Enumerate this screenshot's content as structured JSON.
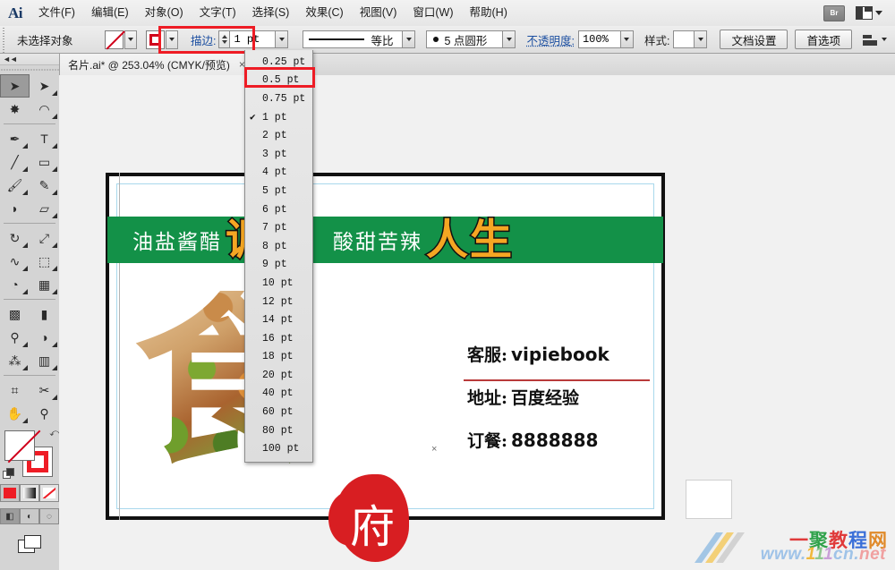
{
  "app": {
    "name": "Ai",
    "logo_text": "Ai"
  },
  "menubar": {
    "items": [
      {
        "label": "文件(F)",
        "name": "menu-file"
      },
      {
        "label": "编辑(E)",
        "name": "menu-edit"
      },
      {
        "label": "对象(O)",
        "name": "menu-object"
      },
      {
        "label": "文字(T)",
        "name": "menu-type"
      },
      {
        "label": "选择(S)",
        "name": "menu-select"
      },
      {
        "label": "效果(C)",
        "name": "menu-effect"
      },
      {
        "label": "视图(V)",
        "name": "menu-view"
      },
      {
        "label": "窗口(W)",
        "name": "menu-window"
      },
      {
        "label": "帮助(H)",
        "name": "menu-help"
      }
    ],
    "bridge_label": "Br",
    "arrange_documents": "arrange-documents-icon"
  },
  "controlbar": {
    "selection_status": "未选择对象",
    "fill_swatch": "none-fill-swatch",
    "stroke_swatch": "red-stroke-swatch",
    "stroke_label": "描边:",
    "stroke_weight_value": "1 pt",
    "stroke_profile": "等比",
    "brush_definition": "5 点圆形",
    "opacity_label": "不透明度:",
    "opacity_value": "100%",
    "style_label": "样式:",
    "document_setup_label": "文档设置",
    "preferences_label": "首选项",
    "align_icon": "align-panel-icon"
  },
  "annotations": {
    "stroke_highlight_color": "#ee1c25",
    "dropdown_highlight_color": "#ee1c25",
    "stroke_highlight_target": "描边: 1 pt",
    "dropdown_highlight_target": "0.5 pt"
  },
  "tabbar": {
    "document_tab": "名片.ai* @ 253.04% (CMYK/预览)",
    "close_label": "×"
  },
  "toolbar": {
    "collapse_label": "◄◄",
    "tools": [
      {
        "name": "selection-tool",
        "glyph": "➤",
        "selected": true,
        "corner": false
      },
      {
        "name": "direct-selection-tool",
        "glyph": "➤",
        "selected": false,
        "corner": true
      },
      {
        "name": "magic-wand-tool",
        "glyph": "✸",
        "selected": false,
        "corner": false
      },
      {
        "name": "lasso-tool",
        "glyph": "◠",
        "selected": false,
        "corner": true
      },
      {
        "name": "pen-tool",
        "glyph": "✒",
        "selected": false,
        "corner": true
      },
      {
        "name": "type-tool",
        "glyph": "T",
        "selected": false,
        "corner": true
      },
      {
        "name": "line-segment-tool",
        "glyph": "╱",
        "selected": false,
        "corner": true
      },
      {
        "name": "rectangle-tool",
        "glyph": "▭",
        "selected": false,
        "corner": true
      },
      {
        "name": "paintbrush-tool",
        "glyph": "🖌",
        "selected": false,
        "corner": true
      },
      {
        "name": "pencil-tool",
        "glyph": "✎",
        "selected": false,
        "corner": true
      },
      {
        "name": "blob-brush-tool",
        "glyph": "◗",
        "selected": false,
        "corner": false
      },
      {
        "name": "eraser-tool",
        "glyph": "▱",
        "selected": false,
        "corner": true
      },
      {
        "name": "rotate-tool",
        "glyph": "↻",
        "selected": false,
        "corner": true
      },
      {
        "name": "scale-tool",
        "glyph": "⤢",
        "selected": false,
        "corner": true
      },
      {
        "name": "width-tool",
        "glyph": "∿",
        "selected": false,
        "corner": true
      },
      {
        "name": "free-transform-tool",
        "glyph": "⬚",
        "selected": false,
        "corner": true
      },
      {
        "name": "shape-builder-tool",
        "glyph": "◔",
        "selected": false,
        "corner": true
      },
      {
        "name": "perspective-grid-tool",
        "glyph": "▦",
        "selected": false,
        "corner": true
      },
      {
        "name": "mesh-tool",
        "glyph": "▩",
        "selected": false,
        "corner": false
      },
      {
        "name": "gradient-tool",
        "glyph": "▮",
        "selected": false,
        "corner": false
      },
      {
        "name": "eyedropper-tool",
        "glyph": "⚲",
        "selected": false,
        "corner": true
      },
      {
        "name": "blend-tool",
        "glyph": "◑",
        "selected": false,
        "corner": true
      },
      {
        "name": "symbol-sprayer-tool",
        "glyph": "⁂",
        "selected": false,
        "corner": true
      },
      {
        "name": "column-graph-tool",
        "glyph": "▥",
        "selected": false,
        "corner": true
      },
      {
        "name": "artboard-tool",
        "glyph": "⌗",
        "selected": false,
        "corner": false
      },
      {
        "name": "slice-tool",
        "glyph": "✂",
        "selected": false,
        "corner": true
      },
      {
        "name": "hand-tool",
        "glyph": "✋",
        "selected": false,
        "corner": true
      },
      {
        "name": "zoom-tool",
        "glyph": "⚲",
        "selected": false,
        "corner": false
      }
    ],
    "fill_swatch_name": "fill-none-swatch",
    "stroke_swatch_name": "stroke-red-swatch",
    "swap_icon": "swap-fill-stroke-icon",
    "default_icon": "default-fill-stroke-icon",
    "color_modes": [
      {
        "name": "color-mode",
        "label": "color",
        "active": false
      },
      {
        "name": "gradient-mode",
        "label": "gradient",
        "active": false
      },
      {
        "name": "none-mode",
        "label": "none",
        "active": false
      }
    ],
    "draw_modes": [
      {
        "name": "draw-normal-mode",
        "label": "●",
        "active": true
      },
      {
        "name": "draw-behind-mode",
        "label": "◐",
        "active": false
      },
      {
        "name": "draw-inside-mode",
        "label": "◌",
        "active": false
      }
    ],
    "screen_mode": "change-screen-mode-icon"
  },
  "dropdown": {
    "name": "stroke-weight-dropdown",
    "selected": "1 pt",
    "highlighted": "0.5 pt",
    "options": [
      "0.25 pt",
      "0.5 pt",
      "0.75 pt",
      "1 pt",
      "2 pt",
      "3 pt",
      "4 pt",
      "5 pt",
      "6 pt",
      "7 pt",
      "8 pt",
      "9 pt",
      "10 pt",
      "12 pt",
      "14 pt",
      "16 pt",
      "18 pt",
      "20 pt",
      "40 pt",
      "60 pt",
      "80 pt",
      "100 pt"
    ]
  },
  "artwork": {
    "banner_color": "#139148",
    "banner_text_left": "油盐酱醋",
    "banner_big_left": "调味",
    "banner_text_right": "酸甜苦辣",
    "banner_big_right": "人生",
    "big_char": "食",
    "seal_char": "府",
    "contact": [
      {
        "key": "客服:",
        "value": "vipiebook",
        "ascii": true
      },
      {
        "key": "地址:",
        "value": "百度经验",
        "ascii": false
      },
      {
        "key": "订餐:",
        "value": "8888888",
        "ascii": true
      }
    ],
    "rule_color": "#b93a3a",
    "center_marker": "×"
  },
  "watermark": {
    "site_name": "一聚教程网",
    "url": "www.111cn.net"
  }
}
